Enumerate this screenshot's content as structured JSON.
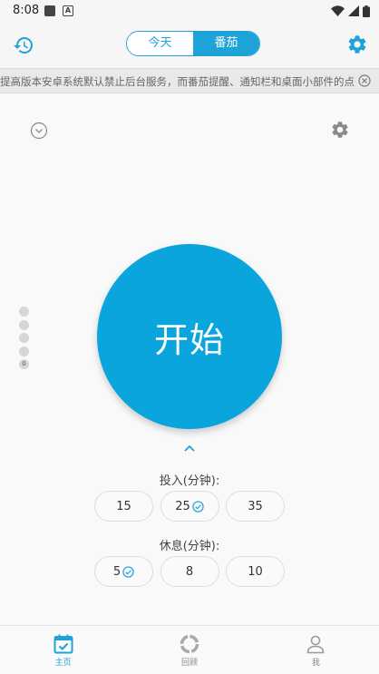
{
  "status_bar": {
    "time": "8:08",
    "notif_icon_letter": "A"
  },
  "app_bar": {
    "tabs": [
      {
        "label": "今天",
        "active": false
      },
      {
        "label": "番茄",
        "active": true
      }
    ]
  },
  "notice": {
    "text": "提高版本安卓系统默认禁止后台服务，而番茄提醒、通知栏和桌面小部件的点击"
  },
  "timer": {
    "start_label": "开始",
    "session_count": "0",
    "focus": {
      "label": "投入(分钟):",
      "options": [
        "15",
        "25",
        "35"
      ],
      "selected": "25"
    },
    "rest": {
      "label": "休息(分钟):",
      "options": [
        "5",
        "8",
        "10"
      ],
      "selected": "5"
    }
  },
  "bottom_nav": [
    {
      "label": "主页",
      "icon": "calendar-check-icon",
      "active": true
    },
    {
      "label": "回顾",
      "icon": "ring-chart-icon",
      "active": false
    },
    {
      "label": "我",
      "icon": "person-icon",
      "active": false
    }
  ],
  "colors": {
    "accent": "#1da3d8",
    "start_button": "#0aa5dc"
  }
}
